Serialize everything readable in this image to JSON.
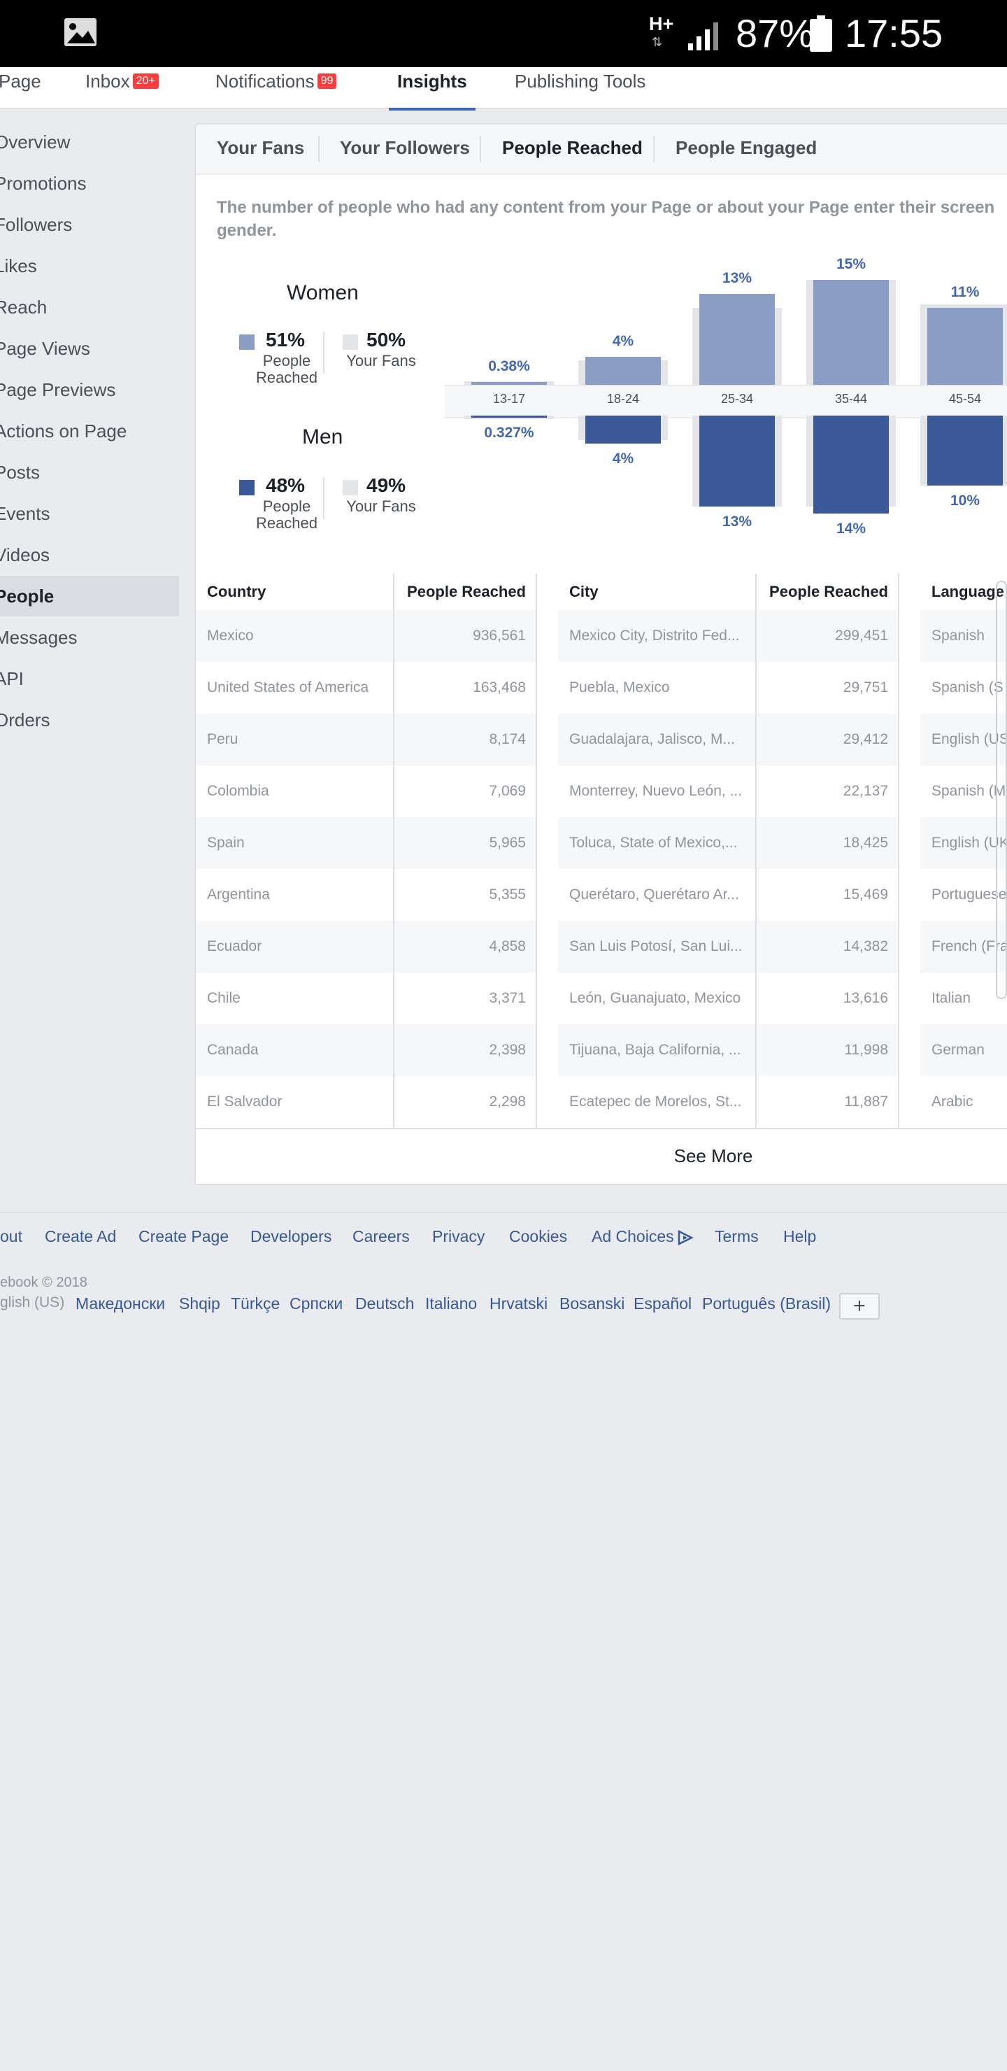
{
  "status_bar": {
    "network": "H+",
    "battery": "87%",
    "time": "17:55"
  },
  "nav": {
    "tabs": [
      {
        "label": "Page"
      },
      {
        "label": "Inbox",
        "badge": "20+"
      },
      {
        "label": "Notifications",
        "badge": "99"
      },
      {
        "label": "Insights",
        "active": true
      },
      {
        "label": "Publishing Tools"
      }
    ]
  },
  "sidebar": {
    "items": [
      {
        "label": "Overview"
      },
      {
        "label": "Promotions"
      },
      {
        "label": "Followers"
      },
      {
        "label": "Likes"
      },
      {
        "label": "Reach"
      },
      {
        "label": "Page Views"
      },
      {
        "label": "Page Previews"
      },
      {
        "label": "Actions on Page"
      },
      {
        "label": "Posts"
      },
      {
        "label": "Events"
      },
      {
        "label": "Videos"
      },
      {
        "label": "People",
        "active": true
      },
      {
        "label": "Messages"
      },
      {
        "label": "API"
      },
      {
        "label": "Orders"
      }
    ]
  },
  "subtabs": [
    {
      "label": "Your Fans"
    },
    {
      "label": "Your Followers"
    },
    {
      "label": "People Reached",
      "active": true
    },
    {
      "label": "People Engaged"
    }
  ],
  "description": "The number of people who had any content from your Page or about your Page enter their screen gender.",
  "summary": {
    "women": {
      "title": "Women",
      "reached_pct": "51%",
      "reached_label": "People Reached",
      "fans_pct": "50%",
      "fans_label": "Your Fans"
    },
    "men": {
      "title": "Men",
      "reached_pct": "48%",
      "reached_label": "People Reached",
      "fans_pct": "49%",
      "fans_label": "Your Fans"
    }
  },
  "chart_data": {
    "type": "bar",
    "categories": [
      "13-17",
      "18-24",
      "25-34",
      "35-44",
      "45-54"
    ],
    "series": [
      {
        "name": "Women",
        "values": [
          0.38,
          4,
          13,
          15,
          11
        ],
        "labels": [
          "0.38%",
          "4%",
          "13%",
          "15%",
          "11%"
        ]
      },
      {
        "name": "Men",
        "values": [
          0.327,
          4,
          13,
          14,
          10
        ],
        "labels": [
          "0.327%",
          "4%",
          "13%",
          "14%",
          "10%"
        ]
      }
    ],
    "fans_women": [
      0.5,
      3.5,
      11,
      15,
      11.5
    ],
    "fans_men": [
      0.5,
      3.5,
      13,
      13,
      10
    ],
    "ymax": 15,
    "colors": {
      "women": "#8b9dc3",
      "men": "#3b5998",
      "fans": "#e4e5e8"
    }
  },
  "tables": {
    "country": {
      "headers": [
        "Country",
        "People Reached"
      ],
      "rows": [
        [
          "Mexico",
          "936,561"
        ],
        [
          "United States of America",
          "163,468"
        ],
        [
          "Peru",
          "8,174"
        ],
        [
          "Colombia",
          "7,069"
        ],
        [
          "Spain",
          "5,965"
        ],
        [
          "Argentina",
          "5,355"
        ],
        [
          "Ecuador",
          "4,858"
        ],
        [
          "Chile",
          "3,371"
        ],
        [
          "Canada",
          "2,398"
        ],
        [
          "El Salvador",
          "2,298"
        ]
      ]
    },
    "city": {
      "headers": [
        "City",
        "People Reached"
      ],
      "rows": [
        [
          "Mexico City, Distrito Fed...",
          "299,451"
        ],
        [
          "Puebla, Mexico",
          "29,751"
        ],
        [
          "Guadalajara, Jalisco, M...",
          "29,412"
        ],
        [
          "Monterrey, Nuevo León, ...",
          "22,137"
        ],
        [
          "Toluca, State of Mexico,...",
          "18,425"
        ],
        [
          "Querétaro, Querétaro Ar...",
          "15,469"
        ],
        [
          "San Luis Potosí, San Lui...",
          "14,382"
        ],
        [
          "León, Guanajuato, Mexico",
          "13,616"
        ],
        [
          "Tijuana, Baja California, ...",
          "11,998"
        ],
        [
          "Ecatepec de Morelos, St...",
          "11,887"
        ]
      ]
    },
    "language": {
      "headers": [
        "Language"
      ],
      "rows": [
        [
          "Spanish"
        ],
        [
          "Spanish (S"
        ],
        [
          "English (US"
        ],
        [
          "Spanish (M"
        ],
        [
          "English (UK"
        ],
        [
          "Portuguese"
        ],
        [
          "French (Fra"
        ],
        [
          "Italian"
        ],
        [
          "German"
        ],
        [
          "Arabic"
        ]
      ]
    }
  },
  "see_more": "See More",
  "footer": {
    "links": [
      "out",
      "Create Ad",
      "Create Page",
      "Developers",
      "Careers",
      "Privacy",
      "Cookies",
      "Ad Choices",
      "Terms",
      "Help"
    ],
    "copyright": "ebook © 2018",
    "current_language": "glish (US)",
    "languages": [
      "Македонски",
      "Shqip",
      "Türkçe",
      "Српски",
      "Deutsch",
      "Italiano",
      "Hrvatski",
      "Bosanski",
      "Español",
      "Português (Brasil)"
    ],
    "add_language": "+"
  }
}
